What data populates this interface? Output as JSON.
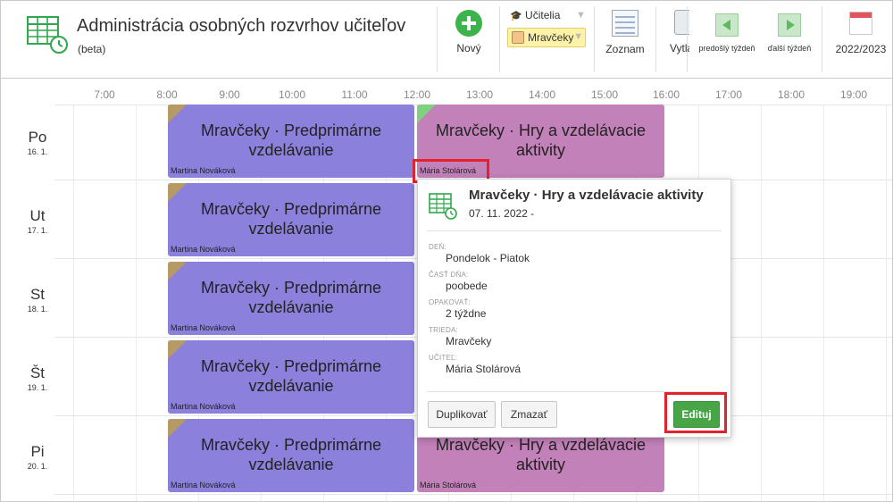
{
  "header": {
    "title": "Administrácia osobných rozvrhov učiteľov",
    "subtitle": "(beta)",
    "new_label": "Nový",
    "teachers_filter": "Učitelia",
    "class_filter": "Mravčeky",
    "list_label": "Zoznam",
    "print_label": "Vytlačiť",
    "prev_week_label": "predošlý týždeň",
    "next_week_label": "ďalší týždeň",
    "year_label": "2022/2023"
  },
  "hours": [
    "7:00",
    "8:00",
    "9:00",
    "10:00",
    "11:00",
    "12:00",
    "13:00",
    "14:00",
    "15:00",
    "16:00",
    "17:00",
    "18:00",
    "19:00"
  ],
  "days": [
    {
      "name": "Po",
      "date": "16. 1."
    },
    {
      "name": "Ut",
      "date": "17. 1."
    },
    {
      "name": "St",
      "date": "18. 1."
    },
    {
      "name": "Št",
      "date": "19. 1."
    },
    {
      "name": "Pi",
      "date": "20. 1."
    }
  ],
  "events": {
    "morning_title": "Mravčeky · Predprimárne vzdelávanie",
    "morning_teacher": "Martina Nováková",
    "afternoon_title": "Mravčeky · Hry a vzdelávacie aktivity",
    "afternoon_teacher": "Mária Stolárová"
  },
  "popup": {
    "title": "Mravčeky · Hry a vzdelávacie aktivity",
    "date": "07. 11. 2022 -",
    "fields": [
      {
        "label": "DEŇ:",
        "value": "Pondelok - Piatok"
      },
      {
        "label": "ČASŤ DŇA:",
        "value": "poobede"
      },
      {
        "label": "OPAKOVAŤ:",
        "value": "2 týždne"
      },
      {
        "label": "TRIEDA:",
        "value": "Mravčeky"
      },
      {
        "label": "UČITEĽ:",
        "value": "Mária Stolárová"
      }
    ],
    "duplicate_label": "Duplikovať",
    "delete_label": "Zmazať",
    "edit_label": "Edituj"
  },
  "colors": {
    "morning_event": "#8b81dc",
    "afternoon_event": "#c381b9",
    "highlight": "#e3222b",
    "edit_button": "#47a447",
    "accent_green": "#3cb44b"
  }
}
